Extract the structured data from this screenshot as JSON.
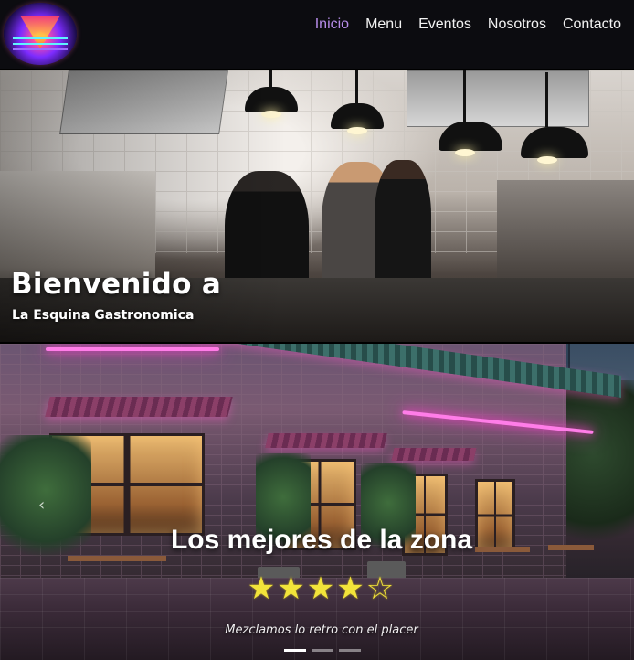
{
  "nav": {
    "logo_name": "retro-sunset-logo",
    "links": [
      {
        "label": "Inicio",
        "active": true
      },
      {
        "label": "Menu",
        "active": false
      },
      {
        "label": "Eventos",
        "active": false
      },
      {
        "label": "Nosotros",
        "active": false
      },
      {
        "label": "Contacto",
        "active": false
      }
    ],
    "active_color": "#b68ce8",
    "link_color": "#f2f2f2"
  },
  "hero": {
    "title": "Bienvenido a",
    "subtitle": "La Esquina Gastronomica"
  },
  "carousel": {
    "heading": "Los mejores de la zona",
    "rating": {
      "filled": 4,
      "total": 5,
      "star_color": "#f2e43a"
    },
    "caption": "Mezclamos lo retro con el placer",
    "slides_count": 3,
    "active_slide": 1,
    "prev_icon": "chevron-left-icon"
  }
}
